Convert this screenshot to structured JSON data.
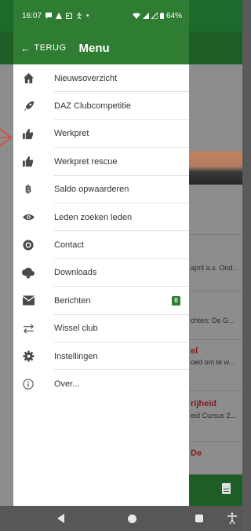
{
  "status_bar": {
    "time": "16:07",
    "battery": "64%"
  },
  "header": {
    "back_label": "TERUG",
    "title": "Menu"
  },
  "menu": [
    {
      "label": "Nieuwsoverzicht",
      "icon": "home-icon"
    },
    {
      "label": "DAZ Clubcompetitie",
      "icon": "rocket-icon"
    },
    {
      "label": "Werkpret",
      "icon": "thumbs-up-icon"
    },
    {
      "label": "Werkpret rescue",
      "icon": "thumbs-up-icon"
    },
    {
      "label": "Saldo opwaarderen",
      "icon": "bitcoin-icon"
    },
    {
      "label": "Leden zoeken leden",
      "icon": "eye-icon"
    },
    {
      "label": "Contact",
      "icon": "at-icon"
    },
    {
      "label": "Downloads",
      "icon": "cloud-download-icon"
    },
    {
      "label": "Berichten",
      "icon": "mail-icon",
      "badge": "0"
    },
    {
      "label": "Wissel club",
      "icon": "swap-icon"
    },
    {
      "label": "Instellingen",
      "icon": "gear-icon"
    },
    {
      "label": "Over...",
      "icon": "info-icon"
    }
  ],
  "background": {
    "text_1": "april a.s. Ond...",
    "text_2": "chten: De G...",
    "title_3": "el",
    "text_3": "oed om te w...",
    "title_4": "rijheid",
    "text_4": "eid Cursus 2...",
    "title_5": "De"
  },
  "colors": {
    "primary": "#2e7d32",
    "badge": "#2e7d32",
    "pointer": "#e2452f"
  }
}
